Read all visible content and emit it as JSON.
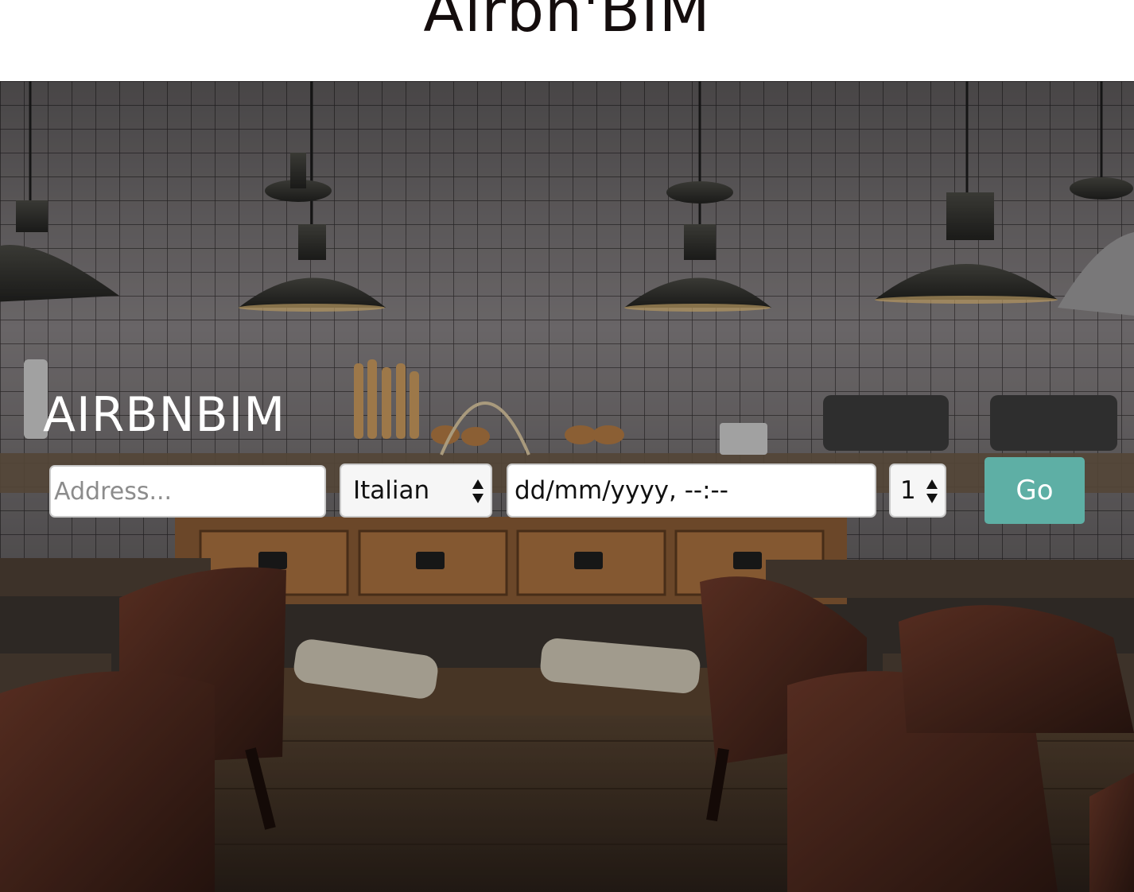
{
  "header": {
    "site_title": "Airbn'BIM"
  },
  "hero": {
    "heading": "AIRBNBIM",
    "background_image": "restaurant-interior-photo"
  },
  "search": {
    "address_placeholder": "Address...",
    "cuisine_selected": "Italian",
    "datetime_value": "dd/mm/yyyy, --:--",
    "guests_selected": "1",
    "go_label": "Go"
  },
  "colors": {
    "accent": "#5eafa5",
    "title_text": "#140d0d",
    "hero_text": "#ffffff"
  }
}
